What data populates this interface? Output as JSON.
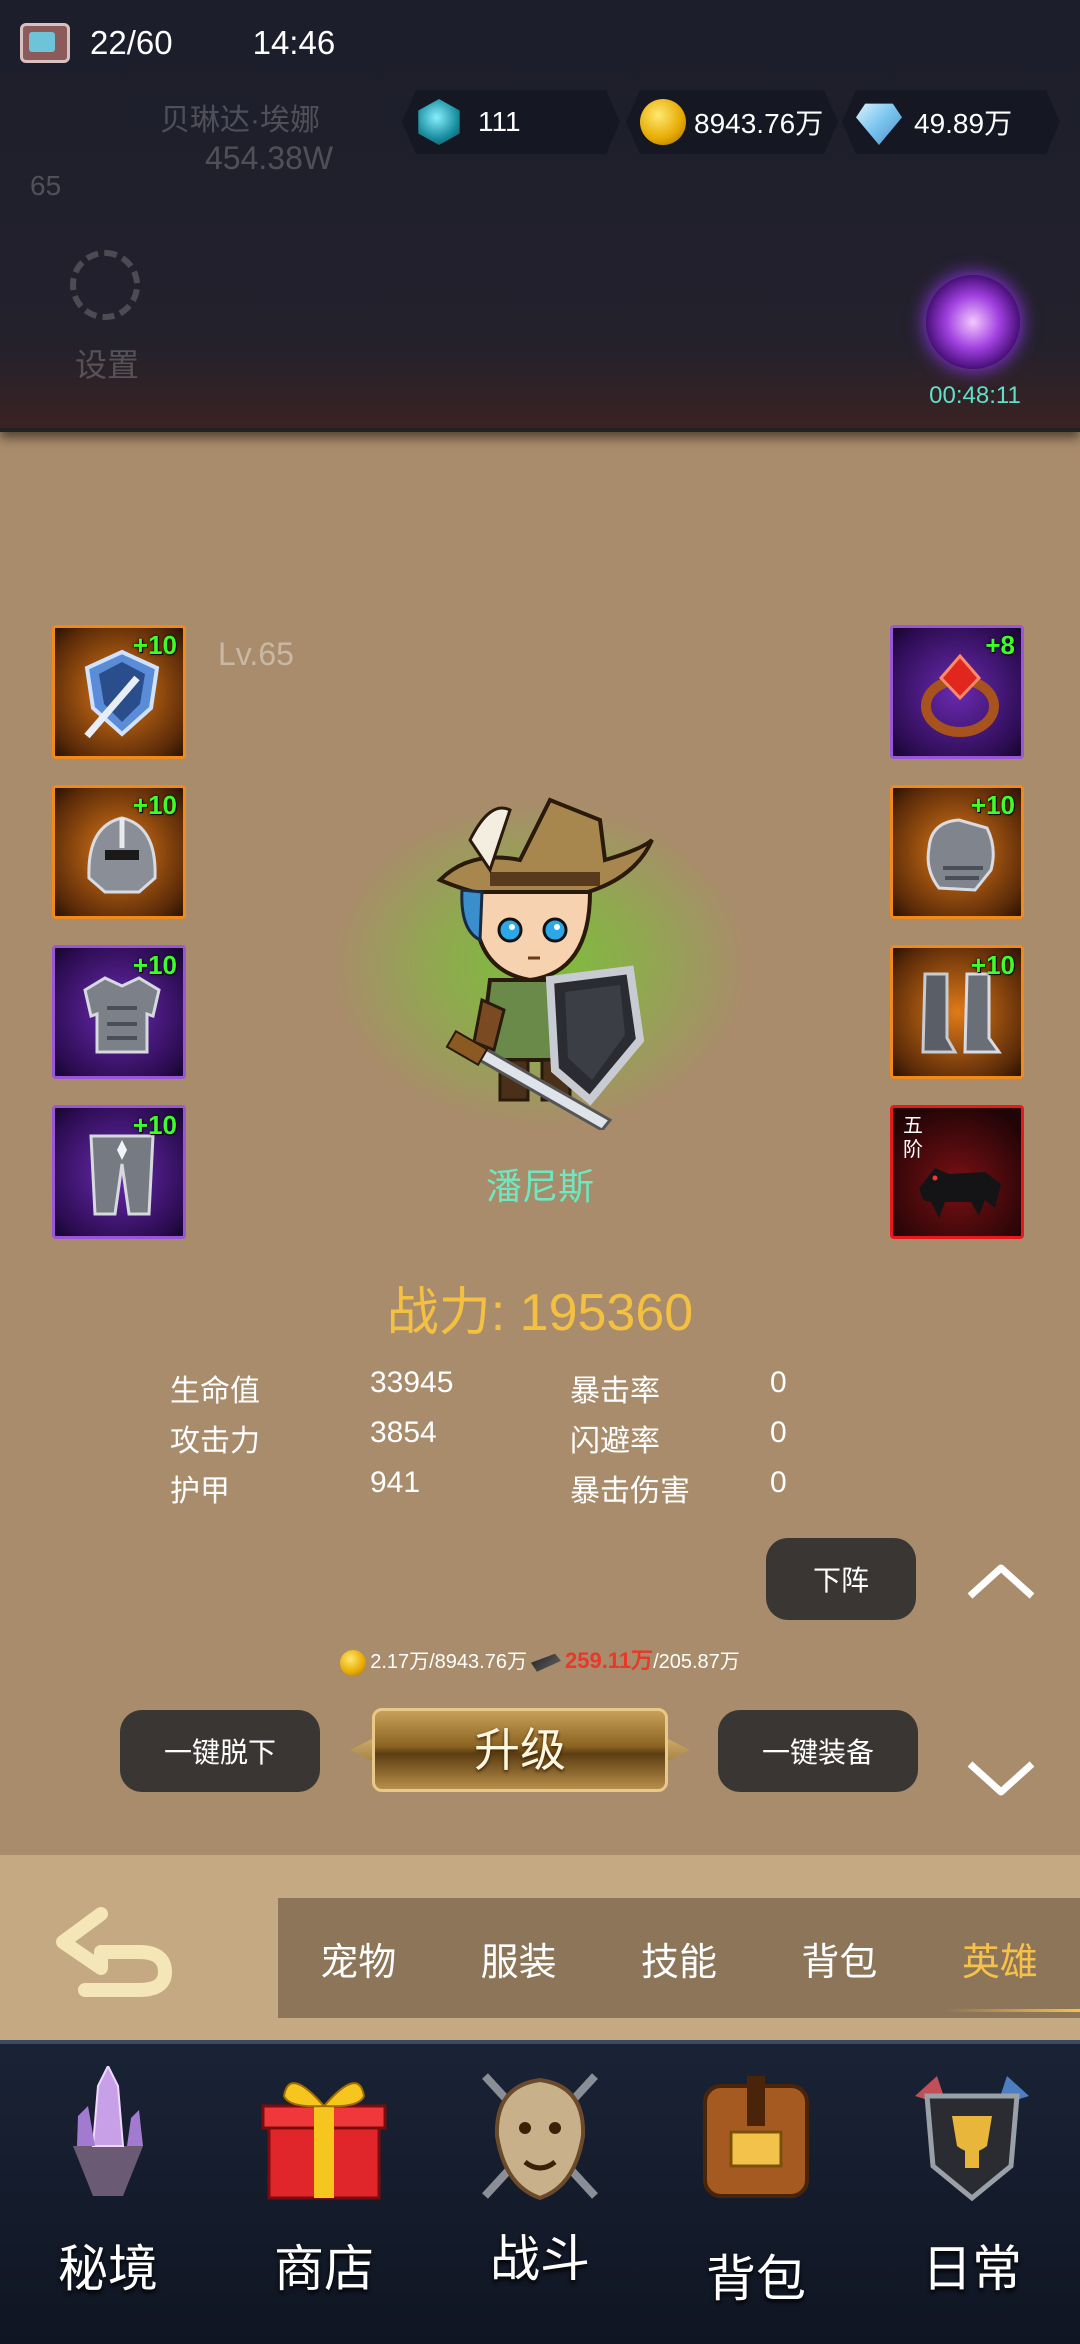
{
  "status": {
    "stamina": "22/60",
    "time": "14:46"
  },
  "player": {
    "name": "贝琳达·埃娜",
    "power": "454.38W",
    "level": "65",
    "settings_label": "设置"
  },
  "currencies": [
    {
      "icon": "crystal-icon",
      "value": "111"
    },
    {
      "icon": "gold-coin-icon",
      "value": "8943.76万"
    },
    {
      "icon": "diamond-icon",
      "value": "49.89万"
    }
  ],
  "orb": {
    "timer": "00:48:11"
  },
  "hero": {
    "level": "Lv.65",
    "name": "潘尼斯",
    "power_label": "战力: 195360"
  },
  "equipment": {
    "left": [
      {
        "name": "shield-sword-equip",
        "level": "+10",
        "rarity": "orange"
      },
      {
        "name": "helmet-equip",
        "level": "+10",
        "rarity": "orange"
      },
      {
        "name": "chest-armor-equip",
        "level": "+10",
        "rarity": "purple"
      },
      {
        "name": "leg-armor-equip",
        "level": "+10",
        "rarity": "purple"
      }
    ],
    "right": [
      {
        "name": "ring-equip",
        "level": "+8",
        "rarity": "purple"
      },
      {
        "name": "gauntlet-equip",
        "level": "+10",
        "rarity": "orange"
      },
      {
        "name": "boots-equip",
        "level": "+10",
        "rarity": "orange"
      },
      {
        "name": "mount-equip",
        "tier": "五阶",
        "rarity": "red"
      }
    ]
  },
  "stats": [
    {
      "label": "生命值",
      "value": "33945"
    },
    {
      "label": "攻击力",
      "value": "3854"
    },
    {
      "label": "护甲",
      "value": "941"
    },
    {
      "label": "暴击率",
      "value": "0"
    },
    {
      "label": "闪避率",
      "value": "0"
    },
    {
      "label": "暴击伤害",
      "value": "0"
    }
  ],
  "buttons": {
    "dismiss": "下阵",
    "unequip_all": "一键脱下",
    "upgrade": "升级",
    "equip_all": "一键装备"
  },
  "cost": {
    "gold": "2.17万/8943.76万",
    "material_have": "259.11万",
    "material_need": "/205.87万"
  },
  "tabs": [
    {
      "label": "宠物",
      "active": false
    },
    {
      "label": "服装",
      "active": false
    },
    {
      "label": "技能",
      "active": false
    },
    {
      "label": "背包",
      "active": false
    },
    {
      "label": "英雄",
      "active": true
    }
  ],
  "nav": [
    {
      "label": "秘境",
      "icon": "crystal-island-icon"
    },
    {
      "label": "商店",
      "icon": "gift-box-icon"
    },
    {
      "label": "战斗",
      "icon": "lion-crest-icon"
    },
    {
      "label": "背包",
      "icon": "backpack-icon"
    },
    {
      "label": "日常",
      "icon": "trophy-shield-icon"
    }
  ],
  "colors": {
    "background": "#a98c6b",
    "power": "#f4c042",
    "hero_name": "#6de8c0",
    "level_badge": "#3cff28",
    "active_tab": "#f6c14a"
  }
}
